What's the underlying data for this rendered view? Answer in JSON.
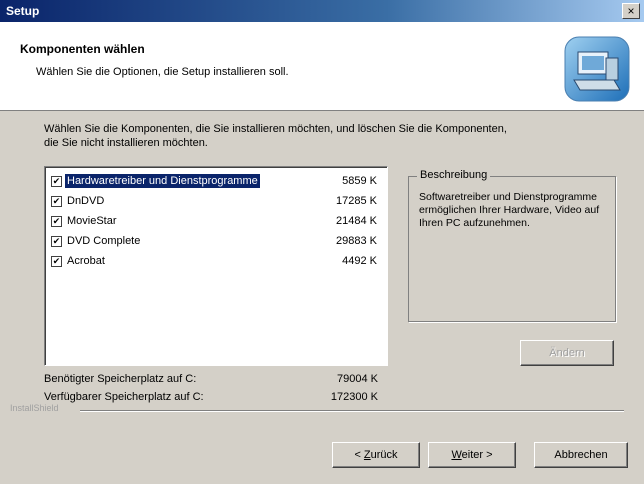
{
  "window": {
    "title": "Setup",
    "close_glyph": "×"
  },
  "header": {
    "heading": "Komponenten wählen",
    "subheading": "Wählen Sie die Optionen, die Setup installieren soll.",
    "logo_icon": "computer-setup-icon"
  },
  "intro": {
    "line1": "Wählen Sie die Komponenten, die Sie installieren möchten, und löschen Sie die Komponenten,",
    "line2": "die Sie nicht installieren möchten."
  },
  "components": [
    {
      "label": "Hardwaretreiber und Dienstprogramme",
      "size": "5859 K",
      "checked": true,
      "selected": true
    },
    {
      "label": "DnDVD",
      "size": "17285 K",
      "checked": true,
      "selected": false
    },
    {
      "label": "MovieStar",
      "size": "21484 K",
      "checked": true,
      "selected": false
    },
    {
      "label": "DVD Complete",
      "size": "29883 K",
      "checked": true,
      "selected": false
    },
    {
      "label": "Acrobat",
      "size": "4492 K",
      "checked": true,
      "selected": false
    }
  ],
  "description": {
    "legend": "Beschreibung",
    "text": "Softwaretreiber und Dienstprogramme ermöglichen Ihrer Hardware, Video auf Ihren PC aufzunehmen."
  },
  "change_button": "Ändern",
  "space": {
    "required_label": "Benötigter Speicherplatz auf C:",
    "required_value": "79004 K",
    "available_label": "Verfügbarer Speicherplatz auf C:",
    "available_value": "172300 K"
  },
  "brand": "InstallShield",
  "buttons": {
    "back_prefix": "< ",
    "back_key": "Z",
    "back_rest": "urück",
    "next_key": "W",
    "next_rest": "eiter >",
    "cancel": "Abbrechen"
  },
  "colors": {
    "selection": "#0a246a",
    "dialog_bg": "#d4d0c8",
    "title_gradient_start": "#0a246a"
  }
}
